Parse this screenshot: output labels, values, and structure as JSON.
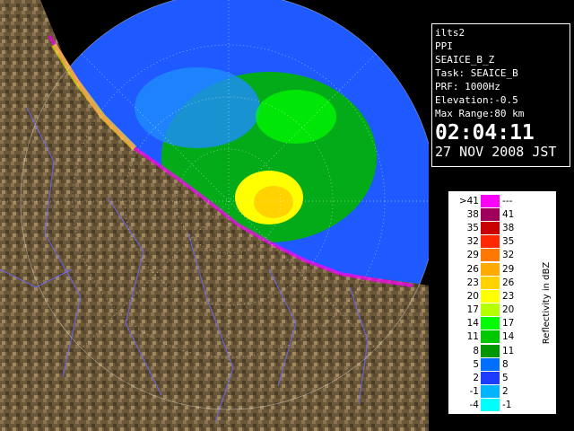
{
  "info": {
    "station": "ilts2",
    "mode": "PPI",
    "product": "SEAICE_B_Z",
    "task": "Task: SEAICE_B",
    "prf": "PRF: 1000Hz",
    "elevation": "Elevation:-0.5",
    "max_range": "Max Range:80 km",
    "time": "02:04:11",
    "date": "27 NOV 2008 JST"
  },
  "legend": {
    "unit_label": "Reflectivity in dBZ",
    "rows": [
      {
        "lo": ">41",
        "hi": "---",
        "color": "#ff00ff"
      },
      {
        "lo": "38",
        "hi": "41",
        "color": "#a0005a"
      },
      {
        "lo": "35",
        "hi": "38",
        "color": "#c80000"
      },
      {
        "lo": "32",
        "hi": "35",
        "color": "#ff2800"
      },
      {
        "lo": "29",
        "hi": "32",
        "color": "#ff7800"
      },
      {
        "lo": "26",
        "hi": "29",
        "color": "#ffaa00"
      },
      {
        "lo": "23",
        "hi": "26",
        "color": "#ffd200"
      },
      {
        "lo": "20",
        "hi": "23",
        "color": "#ffff00"
      },
      {
        "lo": "17",
        "hi": "20",
        "color": "#b4ff00"
      },
      {
        "lo": "14",
        "hi": "17",
        "color": "#00ff00"
      },
      {
        "lo": "11",
        "hi": "14",
        "color": "#00c800"
      },
      {
        "lo": "8",
        "hi": "11",
        "color": "#009600"
      },
      {
        "lo": "5",
        "hi": "8",
        "color": "#006eff"
      },
      {
        "lo": "2",
        "hi": "5",
        "color": "#1e3cff"
      },
      {
        "lo": "-1",
        "hi": "2",
        "color": "#00b4ff"
      },
      {
        "lo": "-4",
        "hi": "-1",
        "color": "#00ffff"
      }
    ]
  },
  "colors": {
    "background": "#000000",
    "sea_echo": "#1e5aff",
    "land": "#6e5a3c",
    "coast": "#ffffff",
    "river": "#6a6aff"
  }
}
